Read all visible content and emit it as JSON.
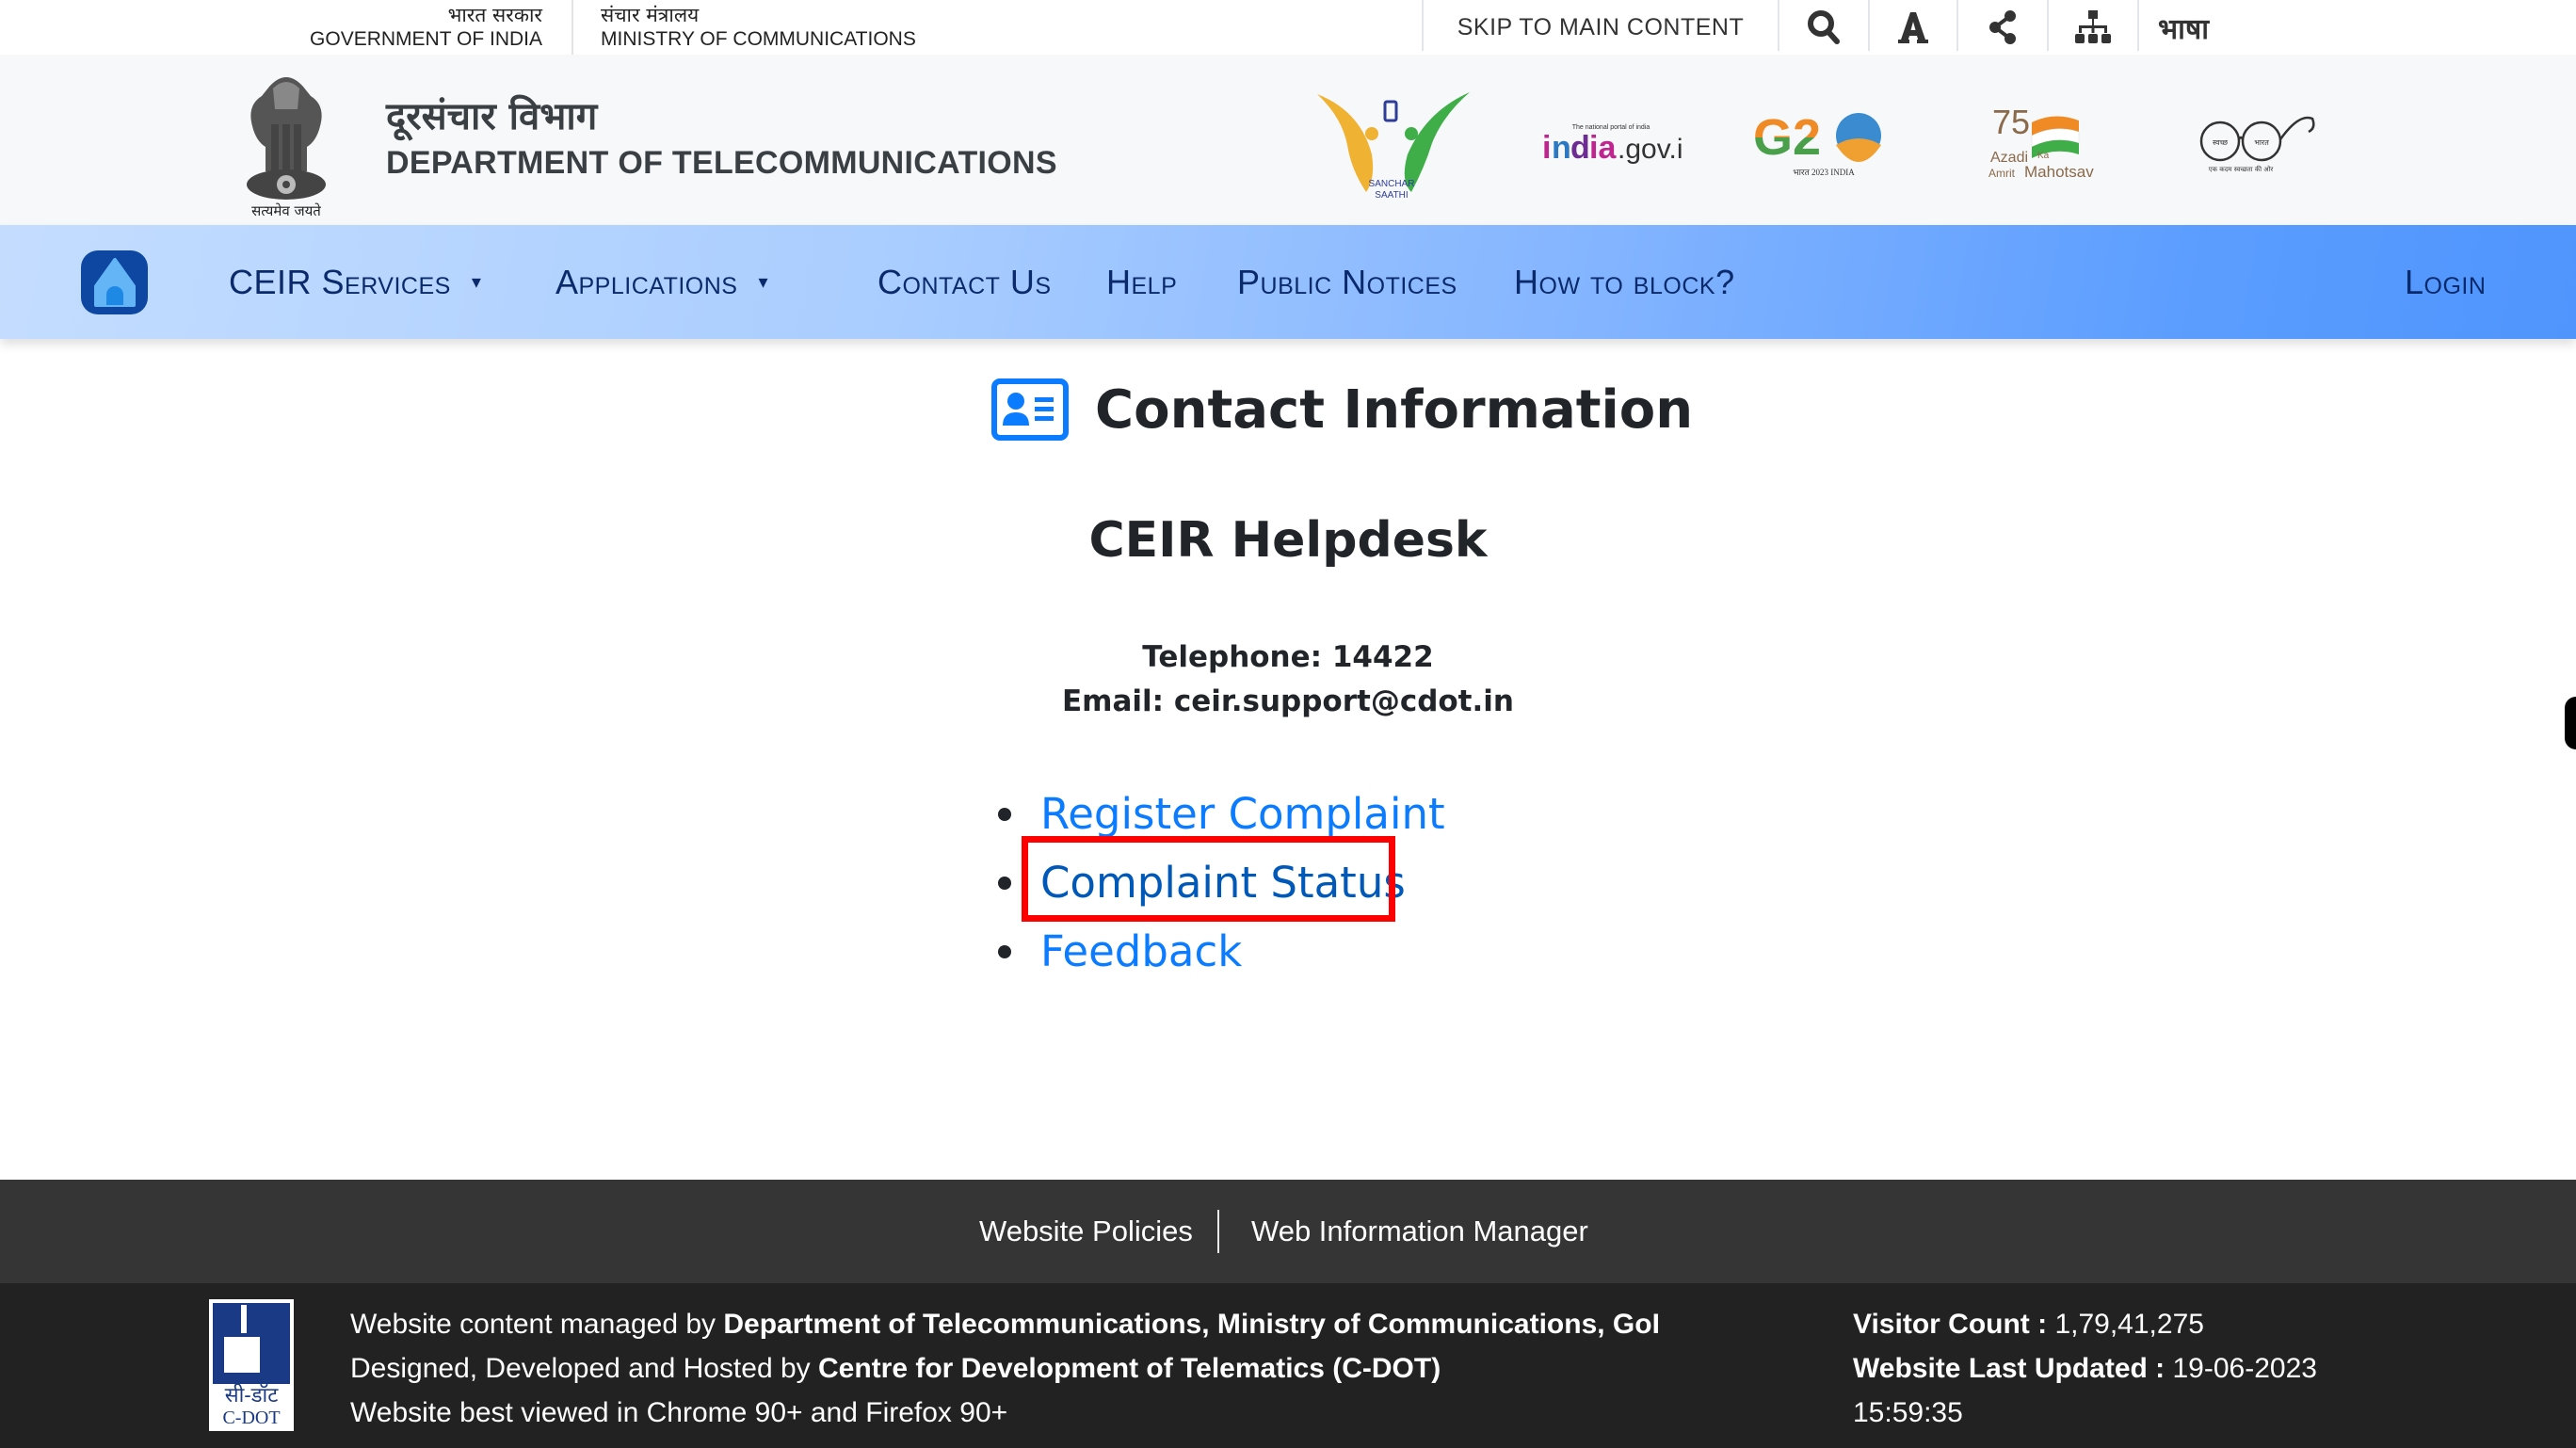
{
  "topbar": {
    "gov_hindi": "भारत सरकार",
    "gov_english": "GOVERNMENT OF INDIA",
    "ministry_hindi": "संचार मंत्रालय",
    "ministry_english": "MINISTRY OF COMMUNICATIONS",
    "skip_link": "SKIP TO MAIN CONTENT",
    "icons": [
      "search-icon",
      "font-size-icon",
      "share-icon",
      "sitemap-icon"
    ],
    "language_label": "भाषा"
  },
  "header": {
    "emblem_motto": "सत्यमेव जयते",
    "dept_hindi": "दूरसंचार विभाग",
    "dept_english": "DEPARTMENT OF TELECOMMUNICATIONS",
    "logos": [
      {
        "name": "Sanchar Saathi",
        "caption": "SANCHAR SAATHI"
      },
      {
        "name": "india.gov.in",
        "caption": "The national portal of india"
      },
      {
        "name": "G20",
        "caption": "2023 INDIA"
      },
      {
        "name": "Azadi Ka Amrit Mahotsav",
        "caption": "Azadi Ka Amrit Mahotsav"
      },
      {
        "name": "Swachh Bharat",
        "caption": "एक कदम स्वच्छता की ओर"
      }
    ]
  },
  "nav": {
    "home_label": "Home",
    "items": [
      {
        "label": "CEIR Services",
        "dropdown": true
      },
      {
        "label": "Applications",
        "dropdown": true
      },
      {
        "label": "Contact Us",
        "dropdown": false
      },
      {
        "label": "Help",
        "dropdown": false
      },
      {
        "label": "Public Notices",
        "dropdown": false
      },
      {
        "label": "How to block?",
        "dropdown": false
      }
    ],
    "login_label": "Login",
    "chevron": "⌄"
  },
  "main": {
    "title": "Contact Information",
    "helpdesk_heading": "CEIR Helpdesk",
    "telephone": "Telephone: 14422",
    "email": "Email: ceir.support@cdot.in",
    "links": [
      {
        "label": "Register Complaint",
        "state": "normal"
      },
      {
        "label": "Complaint Status",
        "state": "hover",
        "highlighted": true
      },
      {
        "label": "Feedback",
        "state": "normal"
      }
    ]
  },
  "footer": {
    "links": [
      "Website Policies",
      "Web Information Manager"
    ],
    "logo_text_hindi": "सी-डॉट",
    "logo_text_english": "C-DOT",
    "managed_prefix": "Website content managed by ",
    "managed_by": "Department of Telecommunications, Ministry of Communications, GoI",
    "designed_prefix": "Designed, Developed and Hosted by ",
    "designed_by": "Centre for Development of Telematics (C-DOT)",
    "browser_note": "Website best viewed in Chrome 90+ and Firefox 90+",
    "visitor_label": "Visitor Count : ",
    "visitor_count": "1,79,41,275",
    "updated_label": "Website Last Updated : ",
    "updated_date": "19-06-2023",
    "updated_time": "15:59:35"
  },
  "colors": {
    "link": "#0b7bff",
    "link_hover": "#0059b8",
    "nav_text": "#0b2a6b",
    "highlight": "#ff0000",
    "home_button": "#0d47a1"
  }
}
